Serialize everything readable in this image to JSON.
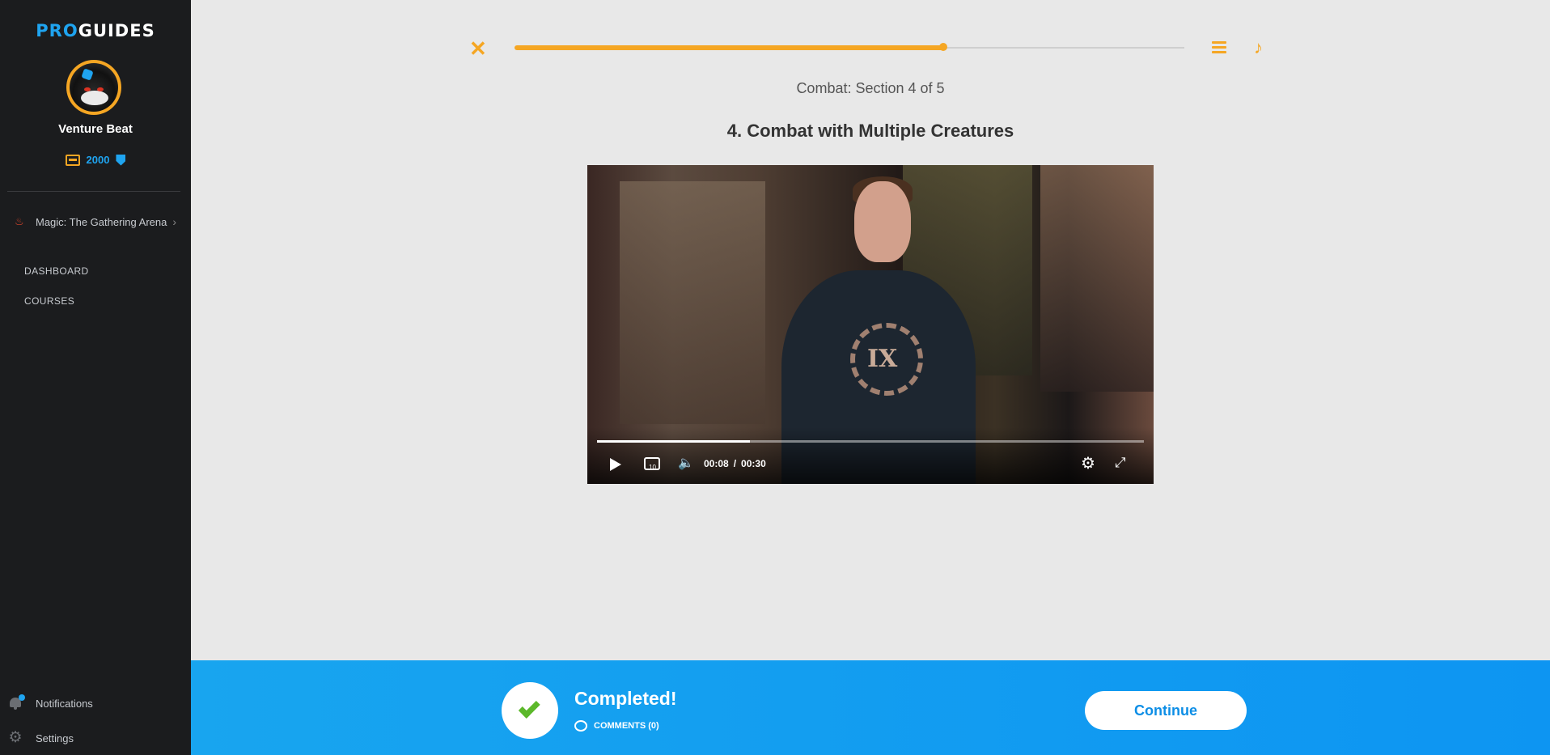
{
  "logo": {
    "pro": "PRO",
    "guides": "GUIDES"
  },
  "user": {
    "name": "Venture Beat",
    "credits": "2000"
  },
  "sidebar": {
    "game": "Magic: The Gathering Arena",
    "nav": [
      {
        "label": "DASHBOARD"
      },
      {
        "label": "COURSES"
      }
    ],
    "bottom": [
      {
        "label": "Notifications"
      },
      {
        "label": "Settings"
      }
    ]
  },
  "course": {
    "section_label": "Combat: Section 4 of 5",
    "lesson_title": "4. Combat with Multiple Creatures",
    "progress_fraction": 0.64
  },
  "video": {
    "current_time": "00:08",
    "separator": "/",
    "duration": "00:30",
    "played_fraction": 0.28,
    "overlay_text": "IX"
  },
  "completion": {
    "title": "Completed!",
    "comments_label": "COMMENTS (0)",
    "continue_label": "Continue"
  },
  "colors": {
    "accent_orange": "#f5a623",
    "brand_blue": "#1fa4f0",
    "sidebar_bg": "#1b1c1e",
    "check_green": "#5cb82a"
  }
}
